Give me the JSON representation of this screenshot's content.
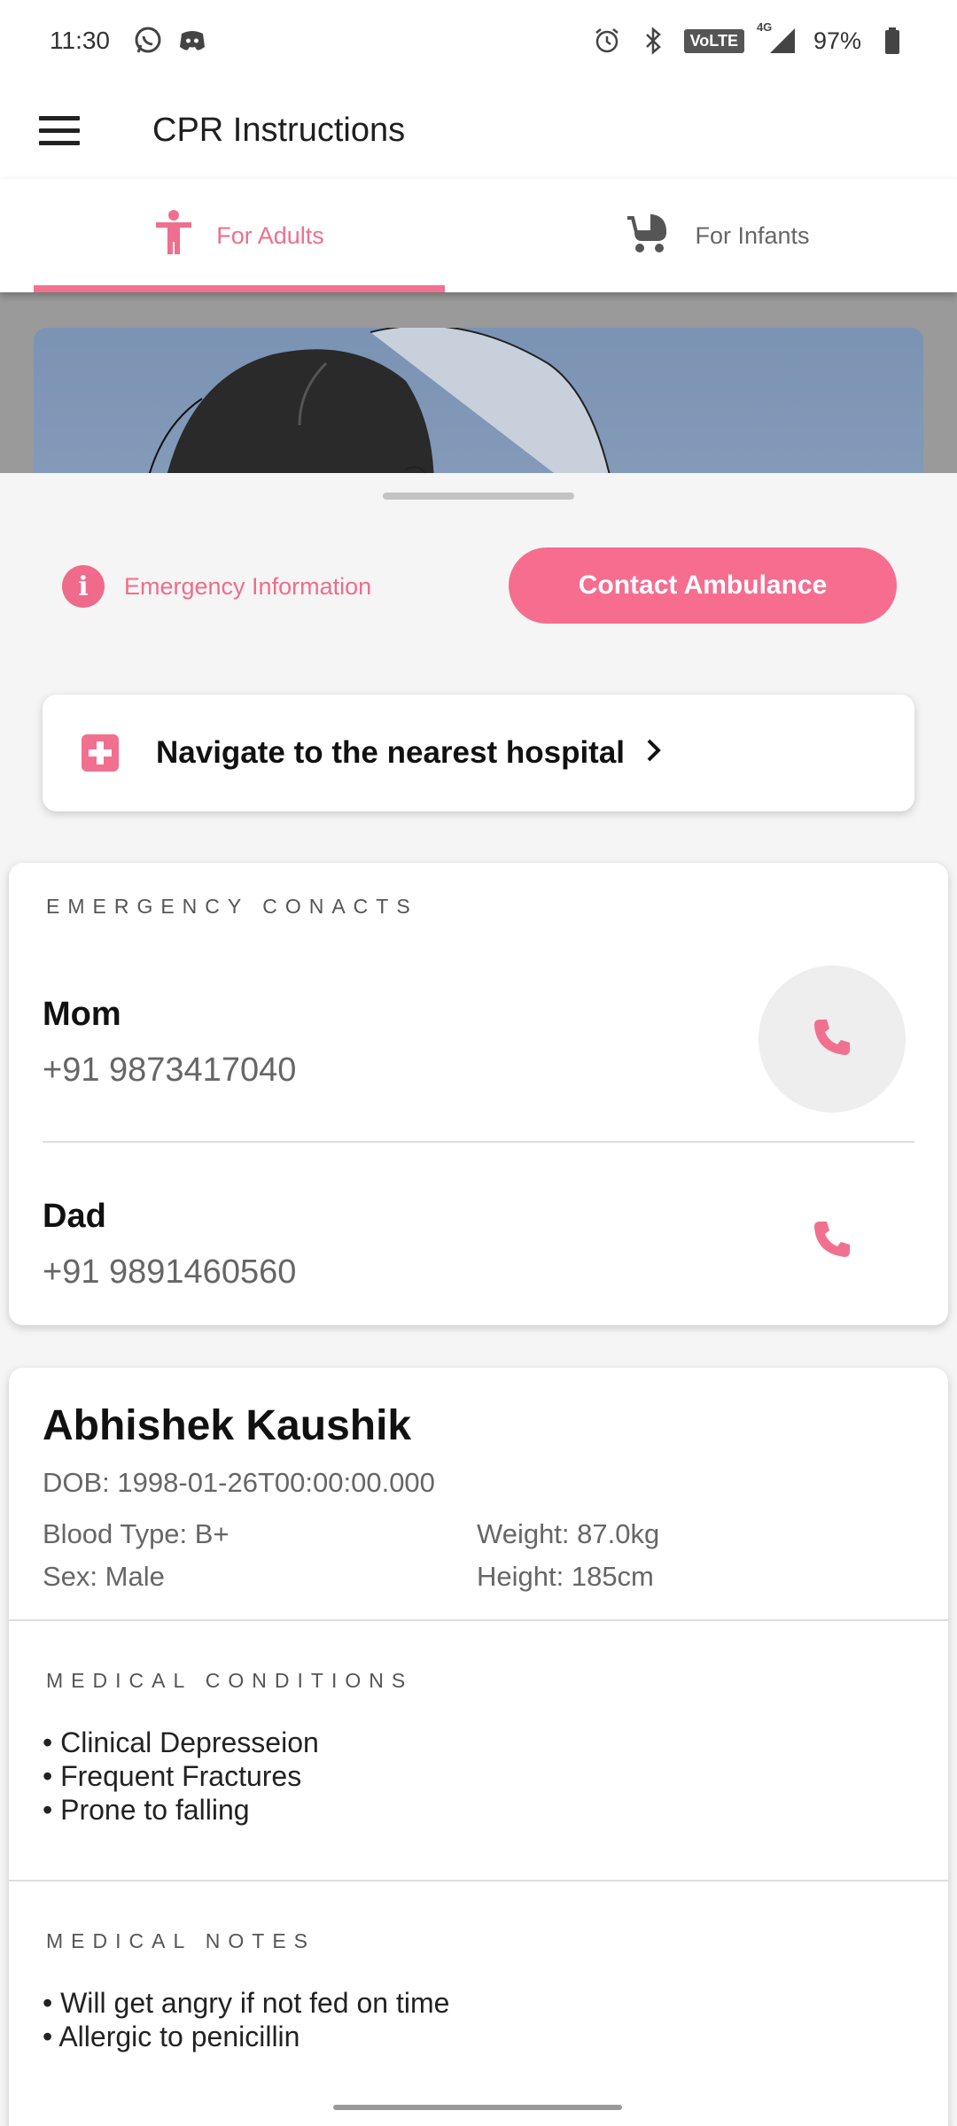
{
  "status_bar": {
    "time": "11:30",
    "left_icons": [
      "whatsapp-icon",
      "discord-icon"
    ],
    "right_icons": [
      "alarm-icon",
      "bluetooth-icon",
      "volte-icon",
      "signal-icon",
      "battery-icon"
    ],
    "volte": "VoLTE",
    "network": "4G",
    "battery": "97%"
  },
  "app_bar": {
    "menu_icon": "hamburger-menu-icon",
    "title": "CPR Instructions"
  },
  "tabs": [
    {
      "label": "For Adults",
      "icon": "person-icon",
      "selected": true
    },
    {
      "label": "For Infants",
      "icon": "stroller-icon",
      "selected": false
    }
  ],
  "actions": {
    "emergency_info_label": "Emergency Information",
    "ambulance_label": "Contact Ambulance",
    "nearest_hospital_label": "Navigate to the nearest hospital"
  },
  "contacts": {
    "heading": "EMERGENCY CONACTS",
    "items": [
      {
        "name": "Mom",
        "phone": "+91 9873417040"
      },
      {
        "name": "Dad",
        "phone": "+91 9891460560"
      }
    ]
  },
  "profile": {
    "name": "Abhishek Kaushik",
    "dob": "DOB: 1998-01-26T00:00:00.000",
    "blood_type": "Blood Type: B+",
    "weight": "Weight: 87.0kg",
    "sex": "Sex: Male",
    "height": "Height: 185cm",
    "conditions_heading": "MEDICAL CONDITIONS",
    "conditions": [
      "• Clinical Depresseion",
      "• Frequent Fractures",
      "• Prone to falling"
    ],
    "notes_heading": "MEDICAL NOTES",
    "notes": [
      "• Will get angry if not fed on time",
      "• Allergic to penicillin"
    ]
  },
  "colors": {
    "accent": "#f2718f",
    "accent_text": "#ee6d8c",
    "background": "#f5f5f5",
    "card": "#ffffff"
  }
}
